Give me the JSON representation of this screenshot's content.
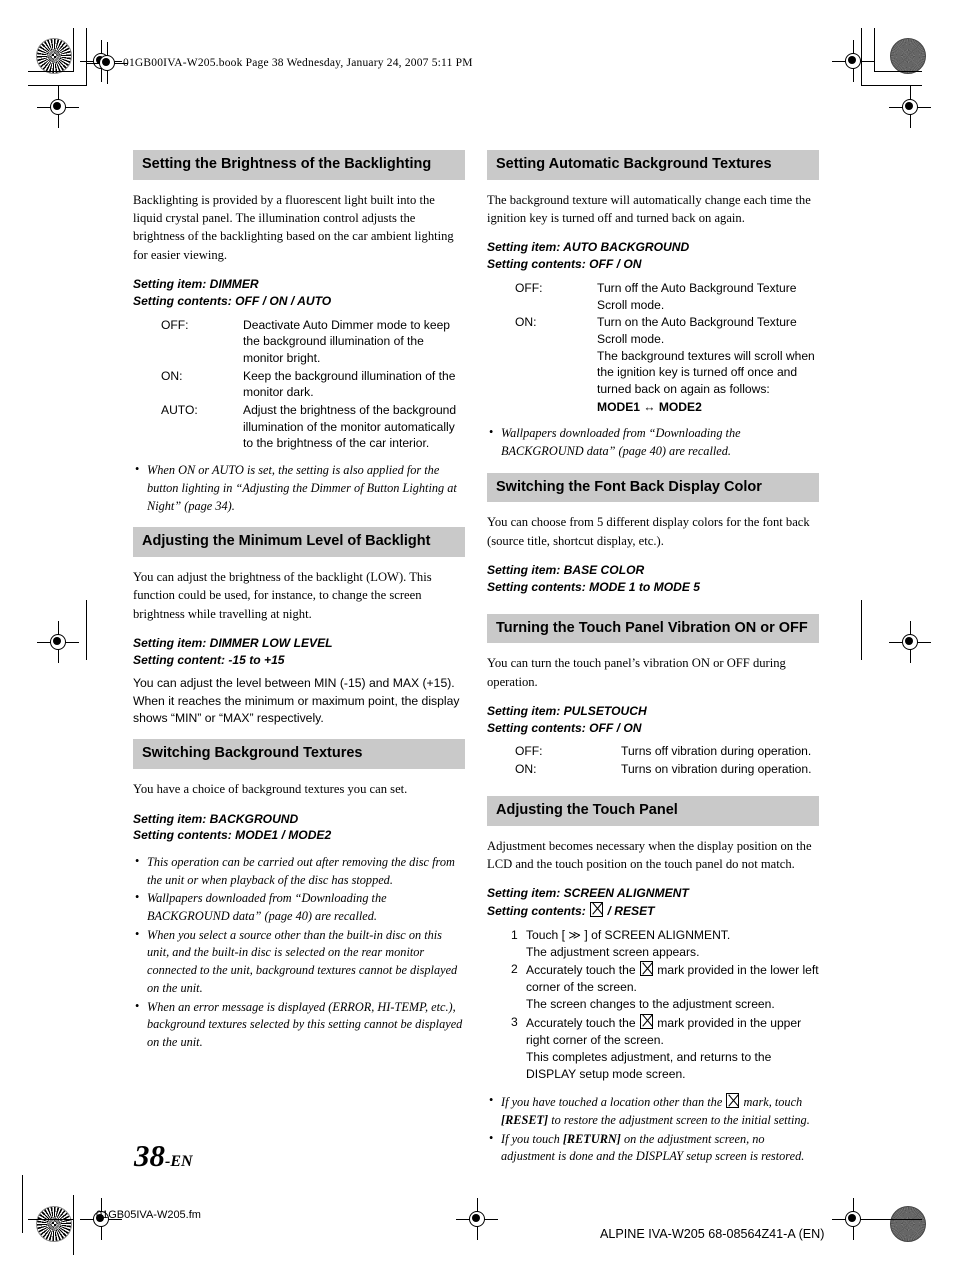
{
  "page": {
    "header_line": "01GB00IVA-W205.book  Page 38  Wednesday, January 24, 2007  5:11 PM",
    "page_number": "38",
    "page_number_suffix": "-EN",
    "footer_left": "01GB05IVA-W205.fm",
    "footer_right": "ALPINE IVA-W205 68-08564Z41-A (EN)",
    "heading_bg": "#c9c9c9"
  },
  "left_column": {
    "sections": [
      {
        "heading": "Setting the Brightness of the Backlighting",
        "body": "Backlighting is provided by a fluorescent light built into the liquid crystal panel. The illumination control adjusts the brightness of the backlighting based on the car ambient lighting for easier viewing.",
        "setting_item": "Setting item: DIMMER",
        "setting_contents": "Setting contents: OFF / ON / AUTO",
        "definitions": [
          {
            "term": "OFF:",
            "desc": "Deactivate Auto Dimmer mode to keep the background illumination of the monitor bright."
          },
          {
            "term": "ON:",
            "desc": "Keep the background illumination of the monitor dark."
          },
          {
            "term": "AUTO:",
            "desc": "Adjust the brightness of the background illumination of the monitor automatically to the brightness of the car interior."
          }
        ],
        "notes": [
          "When ON or AUTO is set, the setting is also applied for the button lighting in “Adjusting the Dimmer of Button Lighting at Night” (page 34)."
        ]
      },
      {
        "heading": "Adjusting the Minimum Level of Backlight",
        "body": "You can adjust the brightness of the backlight (LOW). This function could be used, for instance, to change the screen brightness while travelling at night.",
        "setting_item": "Setting item: DIMMER LOW LEVEL",
        "setting_contents": "Setting content: -15 to +15",
        "body_after": "You can adjust the level between MIN (-15) and MAX (+15). When it reaches the minimum or maximum point, the display shows “MIN” or “MAX” respectively."
      },
      {
        "heading": "Switching Background Textures",
        "body": "You have a choice of background textures you can set.",
        "setting_item": "Setting item: BACKGROUND",
        "setting_contents": "Setting contents: MODE1 / MODE2",
        "notes": [
          "This operation can be carried out after removing the disc from the unit or when playback of the disc has stopped.",
          "Wallpapers downloaded from “Downloading the BACKGROUND data” (page 40) are recalled.",
          "When you select a source other than the built-in disc on this unit, and the built-in disc is selected on the rear monitor connected to the unit, background textures cannot be displayed on the unit.",
          "When an error message is displayed (ERROR, HI-TEMP, etc.), background textures selected by this setting cannot be displayed on the unit."
        ]
      }
    ]
  },
  "right_column": {
    "sections": [
      {
        "heading": "Setting Automatic Background Textures",
        "body": "The background texture will automatically change each time the ignition key is turned off and turned back on again.",
        "setting_item": "Setting item: AUTO BACKGROUND",
        "setting_contents": "Setting contents: OFF / ON",
        "definitions": [
          {
            "term": "OFF:",
            "desc": "Turn off the Auto Background Texture Scroll mode."
          },
          {
            "term": "ON:",
            "desc": "Turn on the Auto Background Texture Scroll mode.",
            "sub": "The background textures will scroll when the ignition key is turned off once and turned back on again as follows:",
            "mode_line": "MODE1 ↔ MODE2"
          }
        ],
        "notes": [
          "Wallpapers downloaded from “Downloading the BACKGROUND data” (page 40) are recalled."
        ]
      },
      {
        "heading": "Switching the Font Back Display Color",
        "body": "You can choose from 5 different display colors for the font back (source title, shortcut display, etc.).",
        "setting_item": "Setting item: BASE COLOR",
        "setting_contents": "Setting contents: MODE 1 to MODE 5"
      },
      {
        "heading": "Turning the Touch Panel Vibration ON or OFF",
        "body": "You can turn the touch panel’s vibration ON or OFF during operation.",
        "setting_item": "Setting item: PULSETOUCH",
        "setting_contents": "Setting contents: OFF / ON",
        "definitions": [
          {
            "term": "OFF:",
            "desc": "Turns off vibration during operation."
          },
          {
            "term": "ON:",
            "desc": "Turns on vibration during operation."
          }
        ]
      },
      {
        "heading": "Adjusting the Touch Panel",
        "body": "Adjustment becomes necessary when the display position on the LCD and the touch position on the touch panel do not match.",
        "setting_item": "Setting item: SCREEN ALIGNMENT",
        "setting_contents_prefix": "Setting contents: ",
        "setting_contents_suffix": " / RESET",
        "steps": [
          {
            "num": "1",
            "text": "Touch [ ≫ ] of SCREEN ALIGNMENT.",
            "result": "The adjustment screen appears."
          },
          {
            "num": "2",
            "text_before": "Accurately touch the ",
            "text_after": " mark provided in the lower left corner of the screen.",
            "result": "The screen changes to the adjustment screen."
          },
          {
            "num": "3",
            "text_before": "Accurately touch the ",
            "text_after": " mark provided in the upper right corner of the screen.",
            "result": "This completes adjustment, and returns to the DISPLAY setup mode screen."
          }
        ],
        "notes_rich": [
          {
            "before": "If you have touched a location other than the ",
            "after_icon": " mark, touch ",
            "bold": "[RESET]",
            "tail": " to restore the adjustment screen to the initial setting."
          },
          {
            "before": "If you touch ",
            "bold": "[RETURN]",
            "tail": " on the adjustment screen, no adjustment is done and the DISPLAY setup screen is restored."
          }
        ]
      }
    ]
  }
}
